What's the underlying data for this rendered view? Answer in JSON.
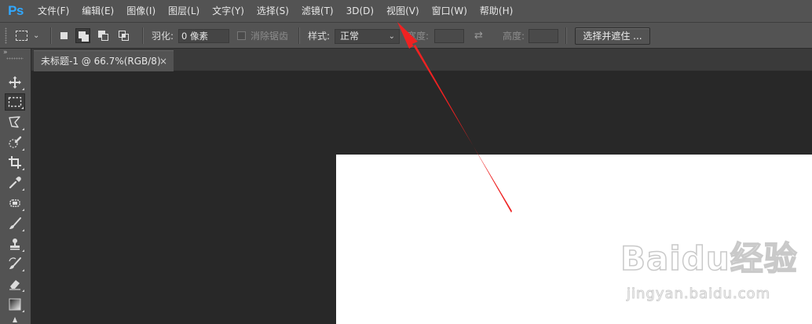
{
  "app": {
    "logo": "Ps"
  },
  "menubar": {
    "items": [
      {
        "label": "文件(F)"
      },
      {
        "label": "编辑(E)"
      },
      {
        "label": "图像(I)"
      },
      {
        "label": "图层(L)"
      },
      {
        "label": "文字(Y)"
      },
      {
        "label": "选择(S)"
      },
      {
        "label": "滤镜(T)"
      },
      {
        "label": "3D(D)"
      },
      {
        "label": "视图(V)"
      },
      {
        "label": "窗口(W)"
      },
      {
        "label": "帮助(H)"
      }
    ]
  },
  "options": {
    "feather_label": "羽化:",
    "feather_value": "0 像素",
    "antialias_label": "消除锯齿",
    "style_label": "样式:",
    "style_value": "正常",
    "width_label": "宽度:",
    "height_label": "高度:",
    "select_mask_button": "选择并遮住 ..."
  },
  "document": {
    "tab_title": "未标题-1 @ 66.7%(RGB/8)",
    "tab_close": "×"
  },
  "tools": [
    {
      "name": "move-tool"
    },
    {
      "name": "rectangular-marquee-tool",
      "active": true
    },
    {
      "name": "lasso-tool"
    },
    {
      "name": "quick-selection-tool"
    },
    {
      "name": "crop-tool"
    },
    {
      "name": "eyedropper-tool"
    },
    {
      "name": "spot-healing-tool"
    },
    {
      "name": "brush-tool"
    },
    {
      "name": "clone-stamp-tool"
    },
    {
      "name": "history-brush-tool"
    },
    {
      "name": "eraser-tool"
    },
    {
      "name": "gradient-tool"
    }
  ],
  "annotation": {
    "color": "#ee2222"
  },
  "watermark": {
    "main": "Baidu经验",
    "sub": "jingyan.baidu.com"
  }
}
